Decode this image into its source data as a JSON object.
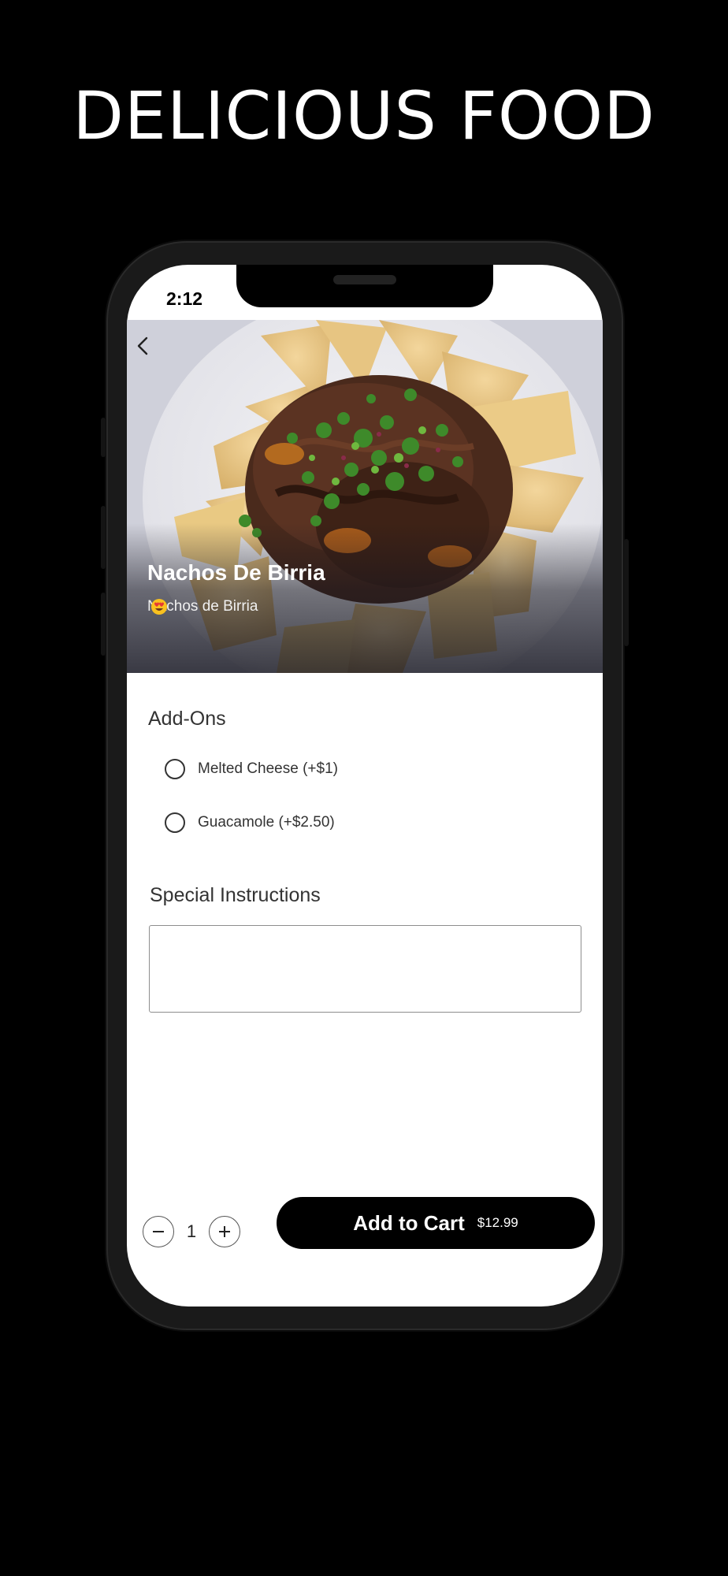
{
  "banner": {
    "headline": "DELICIOUS FOOD"
  },
  "status_bar": {
    "time": "2:12"
  },
  "item": {
    "name": "Nachos De Birria",
    "description": "Nachos de Birria",
    "description_emoji": "heart-eyes-emoji"
  },
  "addons": {
    "title": "Add-Ons",
    "options": [
      {
        "label": "Melted Cheese (+$1)",
        "selected": false
      },
      {
        "label": "Guacamole (+$2.50)",
        "selected": false
      }
    ]
  },
  "instructions": {
    "title": "Special Instructions",
    "value": ""
  },
  "order": {
    "quantity": "1",
    "add_label": "Add to Cart",
    "price": "$12.99"
  },
  "colors": {
    "background": "#000000",
    "screen": "#ffffff",
    "button": "#000000"
  },
  "icons": {
    "back": "chevron-left-icon",
    "minus": "minus-icon",
    "plus": "plus-icon"
  }
}
